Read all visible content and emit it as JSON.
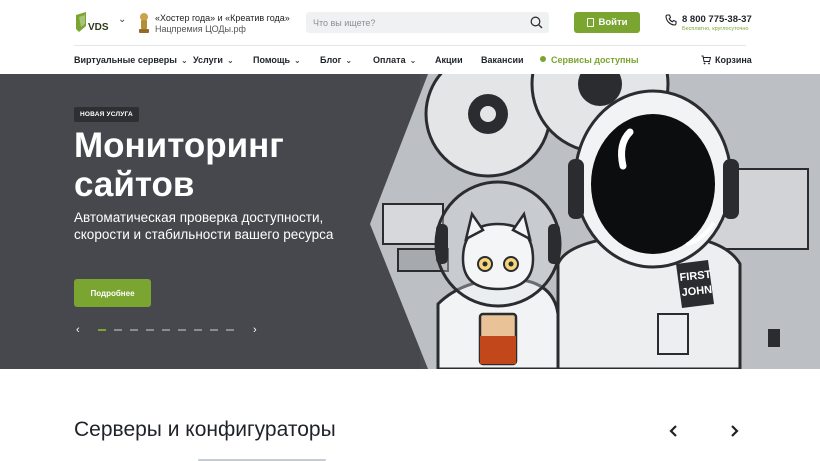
{
  "header": {
    "logo_alt": "VDS",
    "award": {
      "line1": "«Хостер года» и «Креатив года»",
      "line2": "Нацпремия ЦОДы.рф"
    },
    "search": {
      "placeholder": "Что вы ищете?"
    },
    "login_label": "Войти",
    "phone": "8 800 775-38-37",
    "phone_note": "Бесплатно, круглосуточно"
  },
  "nav": {
    "items": [
      {
        "label": "Виртуальные серверы",
        "dropdown": true
      },
      {
        "label": "Услуги",
        "dropdown": true
      },
      {
        "label": "Помощь",
        "dropdown": true
      },
      {
        "label": "Блог",
        "dropdown": true
      },
      {
        "label": "Оплата",
        "dropdown": true
      },
      {
        "label": "Акции",
        "dropdown": false
      },
      {
        "label": "Вакансии",
        "dropdown": false
      }
    ],
    "status": "Сервисы доступны",
    "cart": "Корзина"
  },
  "hero": {
    "badge": "НОВАЯ УСЛУГА",
    "title": "Мониторинг сайтов",
    "description": "Автоматическая проверка доступности, скорости и стабильности вашего ресурса",
    "button": "Подробнее",
    "slides_total": 9,
    "active_slide": 1,
    "art_label_1": "FIRST",
    "art_label_2": "JOHN"
  },
  "section": {
    "title": "Серверы и конфигураторы"
  },
  "colors": {
    "accent": "#7aa531",
    "hero_bg": "#46484d",
    "text": "#1f2328"
  }
}
